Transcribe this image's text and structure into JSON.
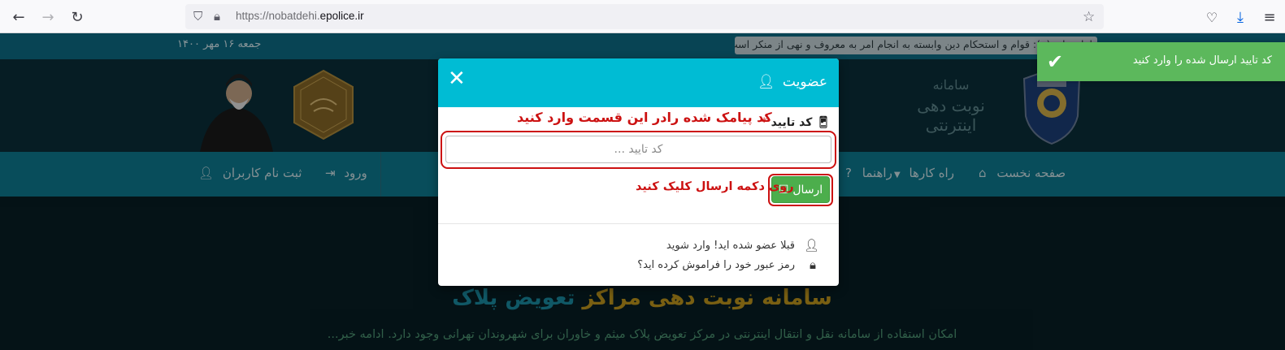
{
  "browser": {
    "url_prefix": "https://nobatdehi.",
    "url_domain": "epolice.ir",
    "icons": [
      "back-icon",
      "forward-icon",
      "reload-icon",
      "shield-icon",
      "lock-icon",
      "star-icon",
      "pocket-icon",
      "download-icon",
      "menu-icon"
    ]
  },
  "top_strip": {
    "date": "جمعه ۱۶ مهر ۱۴۰۰",
    "quote": "امام علی (ع): قوام و استحکام دین وابسته به انجام امر به معروف و نهی از منکر است."
  },
  "header": {
    "site_title_line1": "سامانه",
    "site_title_line2": "نوبت دهی اینترنتی"
  },
  "nav": {
    "home": "صفحه نخست",
    "guides": "راه کارها",
    "help": "راهنما",
    "login": "ورود",
    "register": "ثبت نام کاربران"
  },
  "hero": {
    "title_gold": "سامانه نوبت دهی مراکز",
    "title_teal": "تعویض پلاک",
    "subtitle": "امکان استفاده از سامانه نقل و انتقال اینترنتی در مرکز تعویض پلاک میثم و خاوران برای شهروندان تهرانی وجود دارد. ادامه خبر..."
  },
  "toast": {
    "message": "کد تایید ارسال شده را وارد کنید"
  },
  "modal": {
    "title": "عضویت",
    "close_glyph": "✕",
    "code_label": "کد تایید",
    "required_mark": "*",
    "hint_enter_code": "کد پیامک شده رادر این قسمت وارد کنید",
    "code_placeholder": "کد تایید ...",
    "send_label": "ارسال",
    "hint_click_send": "روی دکمه ارسال کلیک کنید",
    "already_member": "قبلا عضو شده اید! وارد شوید",
    "forgot_password": "رمز عبور خود را فراموش کرده اید؟"
  },
  "colors": {
    "modal_header": "#00bcd4",
    "send_button": "#4cae4c",
    "toast": "#5cb85c",
    "annotation_red": "#cc1111"
  }
}
